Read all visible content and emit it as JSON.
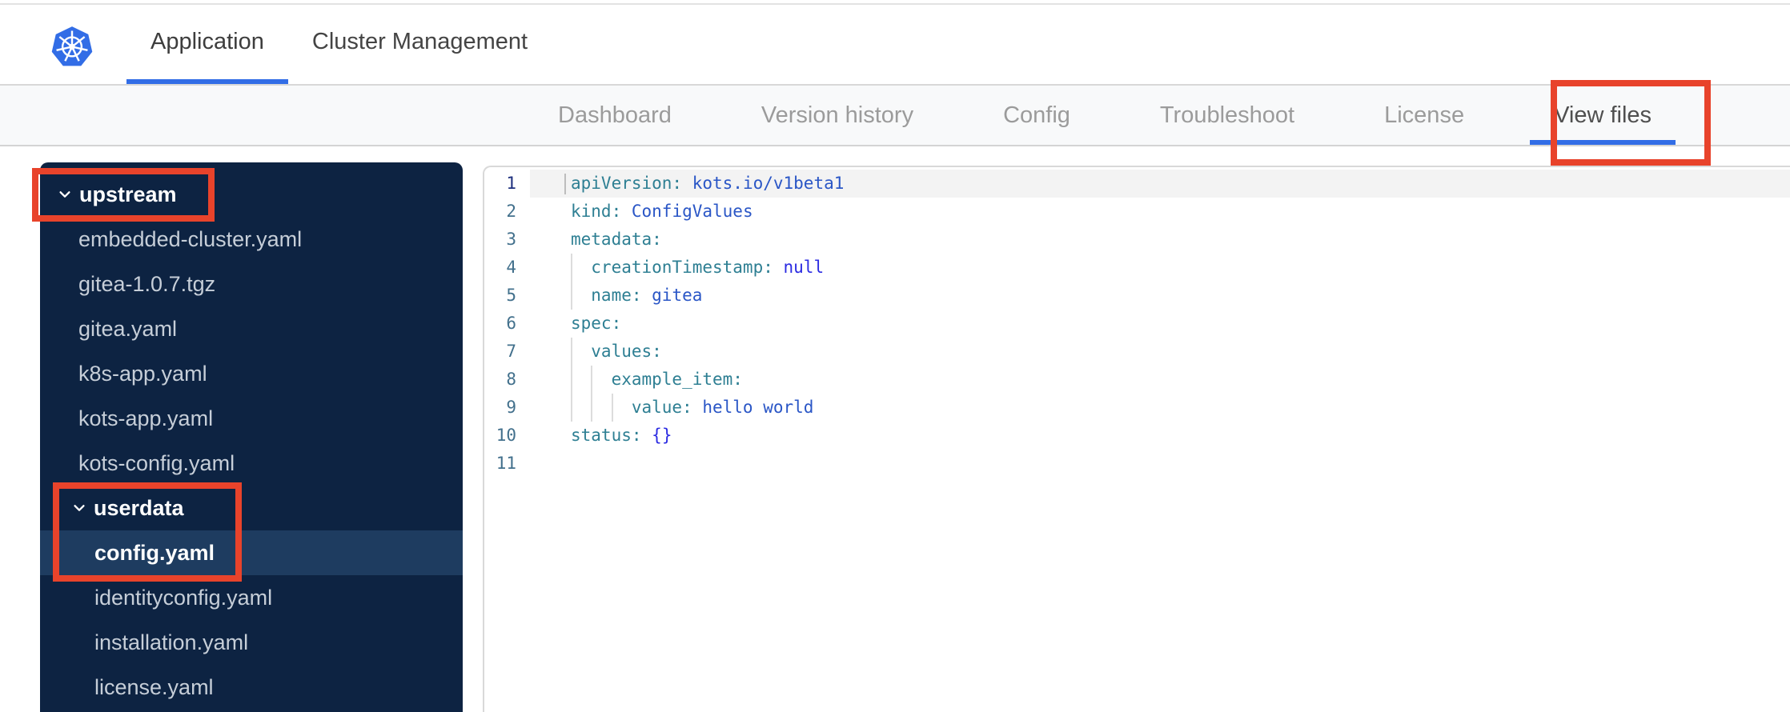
{
  "header": {
    "tabs": [
      {
        "label": "Application",
        "active": true
      },
      {
        "label": "Cluster Management",
        "active": false
      }
    ],
    "logo": "kubernetes-logo"
  },
  "nav": {
    "items": [
      {
        "label": "Dashboard",
        "active": false
      },
      {
        "label": "Version history",
        "active": false
      },
      {
        "label": "Config",
        "active": false
      },
      {
        "label": "Troubleshoot",
        "active": false
      },
      {
        "label": "License",
        "active": false
      },
      {
        "label": "View files",
        "active": true
      }
    ]
  },
  "sidebar": {
    "tree": [
      {
        "label": "upstream",
        "type": "folder",
        "level": 0,
        "expanded": true,
        "selected": false
      },
      {
        "label": "embedded-cluster.yaml",
        "type": "file",
        "level": 1,
        "selected": false
      },
      {
        "label": "gitea-1.0.7.tgz",
        "type": "file",
        "level": 1,
        "selected": false
      },
      {
        "label": "gitea.yaml",
        "type": "file",
        "level": 1,
        "selected": false
      },
      {
        "label": "k8s-app.yaml",
        "type": "file",
        "level": 1,
        "selected": false
      },
      {
        "label": "kots-app.yaml",
        "type": "file",
        "level": 1,
        "selected": false
      },
      {
        "label": "kots-config.yaml",
        "type": "file",
        "level": 1,
        "selected": false
      },
      {
        "label": "userdata",
        "type": "folder",
        "level": 1,
        "expanded": true,
        "selected": false
      },
      {
        "label": "config.yaml",
        "type": "file",
        "level": 2,
        "selected": true
      },
      {
        "label": "identityconfig.yaml",
        "type": "file",
        "level": 2,
        "selected": false
      },
      {
        "label": "installation.yaml",
        "type": "file",
        "level": 2,
        "selected": false
      },
      {
        "label": "license.yaml",
        "type": "file",
        "level": 2,
        "selected": false
      }
    ]
  },
  "editor": {
    "language": "yaml",
    "active_line": 1,
    "lines": [
      {
        "num": 1,
        "segments": [
          {
            "cls": "cursor",
            "text": ""
          },
          {
            "cls": "key",
            "text": "apiVersion:"
          },
          {
            "cls": "plain",
            "text": " "
          },
          {
            "cls": "val",
            "text": "kots.io/v1beta1"
          }
        ]
      },
      {
        "num": 2,
        "segments": [
          {
            "cls": "key",
            "text": "kind:"
          },
          {
            "cls": "plain",
            "text": " "
          },
          {
            "cls": "val",
            "text": "ConfigValues"
          }
        ]
      },
      {
        "num": 3,
        "segments": [
          {
            "cls": "key",
            "text": "metadata:"
          }
        ]
      },
      {
        "num": 4,
        "segments": [
          {
            "cls": "ind",
            "text": ""
          },
          {
            "cls": "key",
            "text": "creationTimestamp:"
          },
          {
            "cls": "plain",
            "text": " "
          },
          {
            "cls": "kw",
            "text": "null"
          }
        ]
      },
      {
        "num": 5,
        "segments": [
          {
            "cls": "ind",
            "text": ""
          },
          {
            "cls": "key",
            "text": "name:"
          },
          {
            "cls": "plain",
            "text": " "
          },
          {
            "cls": "val",
            "text": "gitea"
          }
        ]
      },
      {
        "num": 6,
        "segments": [
          {
            "cls": "key",
            "text": "spec:"
          }
        ]
      },
      {
        "num": 7,
        "segments": [
          {
            "cls": "ind",
            "text": ""
          },
          {
            "cls": "key",
            "text": "values:"
          }
        ]
      },
      {
        "num": 8,
        "segments": [
          {
            "cls": "ind",
            "text": ""
          },
          {
            "cls": "ind",
            "text": ""
          },
          {
            "cls": "key",
            "text": "example_item:"
          }
        ]
      },
      {
        "num": 9,
        "segments": [
          {
            "cls": "ind",
            "text": ""
          },
          {
            "cls": "ind",
            "text": ""
          },
          {
            "cls": "ind",
            "text": ""
          },
          {
            "cls": "key",
            "text": "value:"
          },
          {
            "cls": "plain",
            "text": " "
          },
          {
            "cls": "val",
            "text": "hello world"
          }
        ]
      },
      {
        "num": 10,
        "segments": [
          {
            "cls": "key",
            "text": "status:"
          },
          {
            "cls": "plain",
            "text": " "
          },
          {
            "cls": "kw",
            "text": "{}"
          }
        ]
      },
      {
        "num": 11,
        "segments": []
      }
    ]
  },
  "annotations": [
    {
      "name": "upstream-folder-highlight"
    },
    {
      "name": "userdata-config-highlight"
    },
    {
      "name": "view-files-tab-highlight"
    }
  ],
  "colors": {
    "accent_blue": "#326de6",
    "annotation_red": "#e8432b",
    "sidebar_navy": "#0d2342",
    "sidebar_selected": "#1e3c60",
    "code_key_teal": "#2e7f93",
    "code_value_blue": "#2a56c6",
    "code_keyword_blue": "#2b2be2",
    "line_number": "#42708c"
  }
}
